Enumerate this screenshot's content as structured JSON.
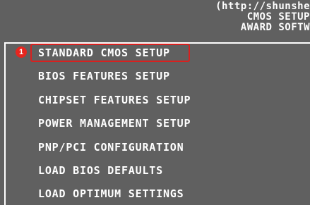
{
  "header": {
    "lines": [
      "(http://shunshe",
      "CMOS SETUP",
      "AWARD SOFTW"
    ]
  },
  "annotation": {
    "step_number": "1",
    "highlight_color": "#d9201f"
  },
  "menu": {
    "items": [
      {
        "label": "STANDARD CMOS SETUP"
      },
      {
        "label": "BIOS FEATURES SETUP"
      },
      {
        "label": "CHIPSET FEATURES SETUP"
      },
      {
        "label": "POWER MANAGEMENT SETUP"
      },
      {
        "label": "PNP/PCI CONFIGURATION"
      },
      {
        "label": "LOAD BIOS DEFAULTS"
      },
      {
        "label": "LOAD OPTIMUM SETTINGS"
      }
    ]
  },
  "colors": {
    "background": "#606060",
    "text": "#ffffff"
  }
}
